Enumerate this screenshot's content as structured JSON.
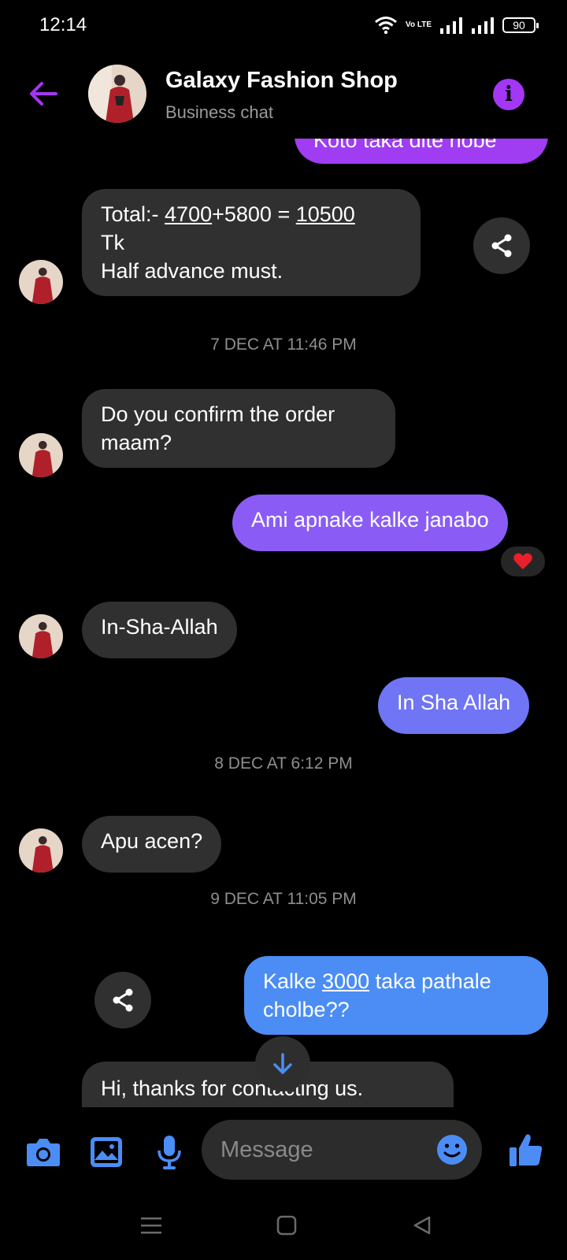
{
  "status_bar": {
    "time": "12:14",
    "network": "Vo LTE",
    "battery": "90"
  },
  "header": {
    "title": "Galaxy Fashion Shop",
    "subtitle": "Business chat"
  },
  "colors": {
    "accent": "#a436f5",
    "incoming_bubble": "#303030",
    "blue": "#4b8df5"
  },
  "messages": {
    "m0": "Koto taka dite hobe",
    "m1": {
      "prefix": "Total:- ",
      "amount1": "4700",
      "mid": "+5800 = ",
      "total": "10500",
      "line2": "Tk",
      "line3": "Half advance must."
    },
    "ts1": "7 DEC AT 11:46 PM",
    "m2": {
      "line1": "Do you confirm the order",
      "line2": "maam?"
    },
    "m3": "Ami apnake kalke janabo",
    "m3_reaction": "heart",
    "m4": "In-Sha-Allah",
    "m5": "In Sha Allah",
    "ts2": "8 DEC AT 6:12 PM",
    "m6": "Apu acen?",
    "ts3": "9 DEC AT 11:05 PM",
    "m7": {
      "prefix": "Kalke ",
      "amount": "3000",
      "suffix": " taka pathale",
      "line2": "cholbe??"
    },
    "m8": "Hi, thanks for contacting us."
  },
  "composer": {
    "placeholder": "Message"
  },
  "icons": [
    "back-arrow-icon",
    "info-icon",
    "share-icon",
    "heart-icon",
    "arrow-down-icon",
    "camera-icon",
    "image-icon",
    "microphone-icon",
    "emoji-icon",
    "thumbs-up-icon",
    "menu-icon",
    "home-icon",
    "back-icon"
  ]
}
